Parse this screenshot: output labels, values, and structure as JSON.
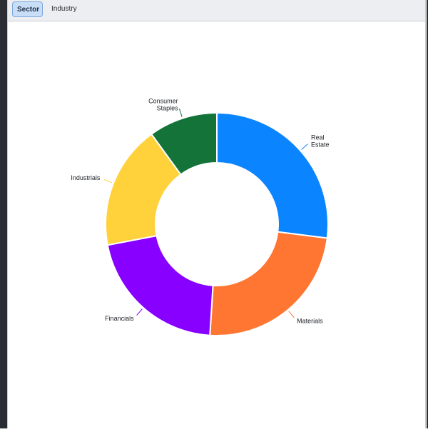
{
  "tabs": [
    {
      "label": "Sector",
      "active": true
    },
    {
      "label": "Industry",
      "active": false
    }
  ],
  "chart_data": {
    "type": "pie",
    "donut": true,
    "categories": [
      "Real Estate",
      "Materials",
      "Financials",
      "Industrials",
      "Consumer Staples"
    ],
    "label_lines": [
      [
        "Real",
        "Estate"
      ],
      [
        "Materials"
      ],
      [
        "Financials"
      ],
      [
        "Industrials"
      ],
      [
        "Consumer",
        "Staples"
      ]
    ],
    "values": [
      27,
      24,
      21,
      18,
      10
    ],
    "colors": [
      "#0a84ff",
      "#ff7633",
      "#8800ff",
      "#ffd13b",
      "#137339"
    ],
    "start_angle_deg": 0,
    "direction": "clockwise",
    "legend": "none",
    "title": ""
  }
}
